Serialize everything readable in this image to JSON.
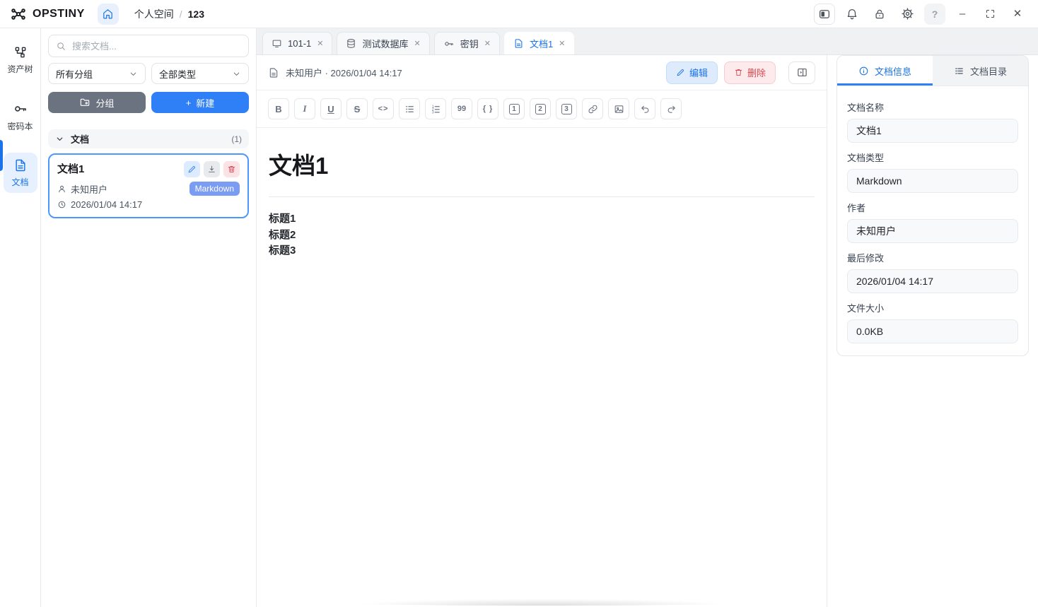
{
  "topbar": {
    "brand": "OPSTINY",
    "breadcrumb": {
      "root": "个人空间",
      "separator": "/",
      "current": "123"
    },
    "help_glyph": "?",
    "minimize_glyph": "–",
    "close_glyph": "✕"
  },
  "rail": {
    "items": [
      {
        "label": "资产树",
        "icon": "asset-tree-icon",
        "active": false
      },
      {
        "label": "密码本",
        "icon": "key-icon",
        "active": false
      },
      {
        "label": "文档",
        "icon": "document-icon",
        "active": true
      }
    ]
  },
  "sidebar": {
    "search_placeholder": "搜索文档...",
    "group_select": "所有分组",
    "type_select": "全部类型",
    "group_button": "分组",
    "new_plus": "+",
    "new_button": "新建",
    "section_title": "文档",
    "section_count": "(1)",
    "card": {
      "title": "文档1",
      "author": "未知用户",
      "badge": "Markdown",
      "time": "2026/01/04 14:17"
    }
  },
  "tabs": [
    {
      "label": "101-1",
      "icon": "monitor-icon",
      "close": "✕",
      "active": false
    },
    {
      "label": "测试数据库",
      "icon": "database-icon",
      "close": "✕",
      "active": false
    },
    {
      "label": "密钥",
      "icon": "key-icon",
      "close": "✕",
      "active": false
    },
    {
      "label": "文档1",
      "icon": "document-icon",
      "close": "✕",
      "active": true
    }
  ],
  "doc": {
    "meta": "未知用户 · 2026/01/04 14:17",
    "edit_button": "编辑",
    "delete_button": "删除",
    "title": "文档1",
    "lines": [
      "标题1",
      "标题2",
      "标题3"
    ]
  },
  "toolbar": {
    "items": [
      {
        "name": "bold-icon",
        "glyph": "B"
      },
      {
        "name": "italic-icon",
        "glyph": "I"
      },
      {
        "name": "underline-icon",
        "glyph": "U"
      },
      {
        "name": "strikethrough-icon",
        "glyph": "S"
      },
      {
        "name": "inline-code-icon",
        "glyph": "<>"
      },
      {
        "name": "bullet-list-icon",
        "glyph": ""
      },
      {
        "name": "ordered-list-icon",
        "glyph": ""
      },
      {
        "name": "quote-icon",
        "glyph": "99"
      },
      {
        "name": "code-block-icon",
        "glyph": "{ }"
      },
      {
        "name": "heading-1-icon",
        "glyph": "1"
      },
      {
        "name": "heading-2-icon",
        "glyph": "2"
      },
      {
        "name": "heading-3-icon",
        "glyph": "3"
      },
      {
        "name": "link-icon",
        "glyph": ""
      },
      {
        "name": "image-icon",
        "glyph": ""
      },
      {
        "name": "undo-icon",
        "glyph": ""
      },
      {
        "name": "redo-icon",
        "glyph": ""
      }
    ]
  },
  "info_panel": {
    "tabs": [
      {
        "label": "文档信息",
        "icon": "info-icon",
        "active": true
      },
      {
        "label": "文档目录",
        "icon": "toc-icon",
        "active": false
      }
    ],
    "fields": [
      {
        "label": "文档名称",
        "value": "文档1"
      },
      {
        "label": "文档类型",
        "value": "Markdown"
      },
      {
        "label": "作者",
        "value": "未知用户"
      },
      {
        "label": "最后修改",
        "value": "2026/01/04 14:17"
      },
      {
        "label": "文件大小",
        "value": "0.0KB"
      }
    ]
  },
  "colors": {
    "accent": "#1a73e8",
    "accent_light": "#e8f0fe",
    "primary_button": "#2f7ff7",
    "gray_button": "#6b7280",
    "danger": "#e0474e",
    "danger_light": "#fdeaec",
    "badge_markdown": "#7b9cf3",
    "tabstrip_bg": "#eff1f3",
    "card_selected_border": "#4c97ff",
    "border": "#e5e7eb"
  }
}
